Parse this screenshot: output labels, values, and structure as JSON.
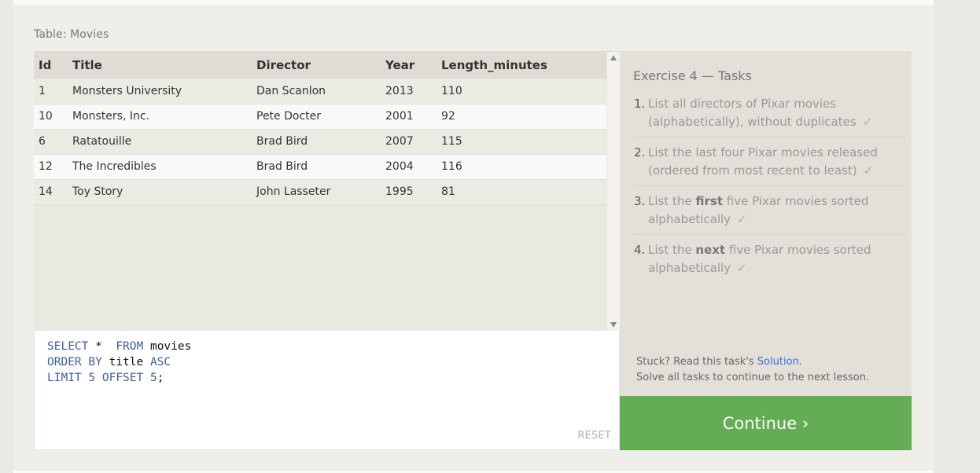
{
  "table_caption": "Table: Movies",
  "results": {
    "columns": [
      "Id",
      "Title",
      "Director",
      "Year",
      "Length_minutes"
    ],
    "rows": [
      [
        "1",
        "Monsters University",
        "Dan Scanlon",
        "2013",
        "110"
      ],
      [
        "10",
        "Monsters, Inc.",
        "Pete Docter",
        "2001",
        "92"
      ],
      [
        "6",
        "Ratatouille",
        "Brad Bird",
        "2007",
        "115"
      ],
      [
        "12",
        "The Incredibles",
        "Brad Bird",
        "2004",
        "116"
      ],
      [
        "14",
        "Toy Story",
        "John Lasseter",
        "1995",
        "81"
      ]
    ]
  },
  "editor": {
    "line1": {
      "kw1": "SELECT",
      "star": " *  ",
      "kw2": "FROM",
      "ident": " movies"
    },
    "line2": {
      "kw1": "ORDER BY",
      "ident": " title ",
      "kw2": "ASC"
    },
    "line3": {
      "kw1": "LIMIT",
      "n1": " 5",
      "kw2": " OFFSET",
      "n2": " 5",
      "end": ";"
    },
    "reset_label": "RESET"
  },
  "exercise": {
    "title": "Exercise 4 — Tasks",
    "tasks": [
      {
        "num": "1.",
        "pre": "List all directors of Pixar movies (alphabetically), without duplicates",
        "strong": "",
        "post": "",
        "check": "✓"
      },
      {
        "num": "2.",
        "pre": "List the last four Pixar movies released (ordered from most recent to least)",
        "strong": "",
        "post": "",
        "check": "✓"
      },
      {
        "num": "3.",
        "pre": "List the ",
        "strong": "first",
        "post": " five Pixar movies sorted alphabetically",
        "check": "✓"
      },
      {
        "num": "4.",
        "pre": "List the ",
        "strong": "next",
        "post": " five Pixar movies sorted alphabetically",
        "check": "✓"
      }
    ]
  },
  "help": {
    "stuck_prefix": "Stuck? Read this task's ",
    "solution_link": "Solution",
    "stuck_suffix": ".",
    "solve_all": "Solve all tasks to continue to the next lesson."
  },
  "continue_label": "Continue ›",
  "colors": {
    "continue_bg": "#63ad54",
    "link": "#3b6ed0",
    "check": "#8dc58c",
    "keyword": "#3e5e9c"
  }
}
